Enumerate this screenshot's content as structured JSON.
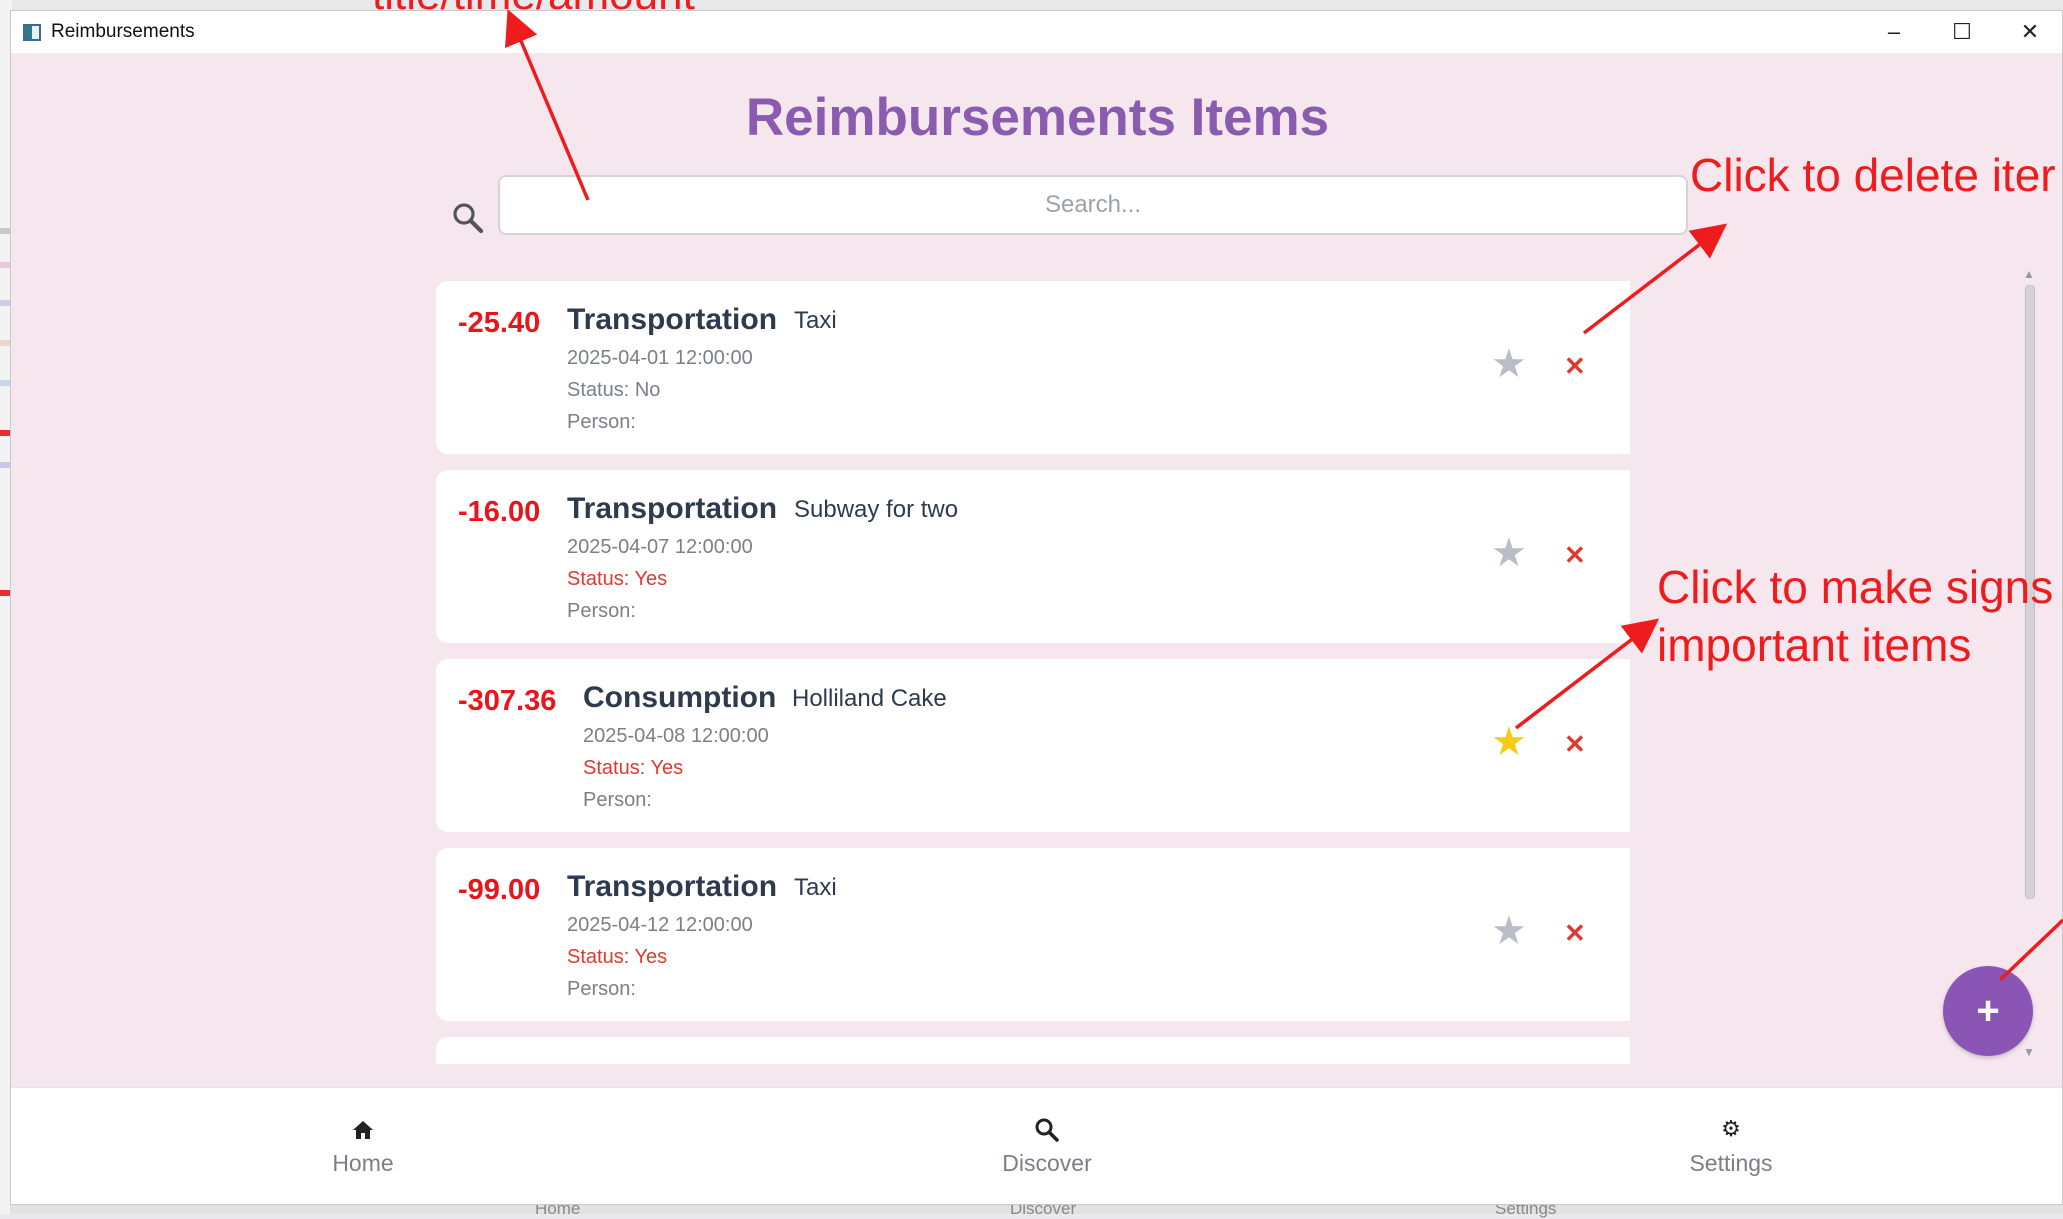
{
  "window": {
    "title": "Reimbursements",
    "controls": {
      "minimize": "–",
      "maximize": "☐",
      "close": "✕"
    }
  },
  "header": {
    "title": "Reimbursements Items",
    "search_placeholder": "Search..."
  },
  "items": [
    {
      "amount": "-25.40",
      "category": "Transportation",
      "description": "Taxi",
      "date": "2025-04-01 12:00:00",
      "status": "Status: No",
      "person": "Person:",
      "starred": false
    },
    {
      "amount": "-16.00",
      "category": "Transportation",
      "description": "Subway for two",
      "date": "2025-04-07 12:00:00",
      "status": "Status: Yes",
      "person": "Person:",
      "starred": false
    },
    {
      "amount": "-307.36",
      "category": "Consumption",
      "description": "Holliland Cake",
      "date": "2025-04-08 12:00:00",
      "status": "Status: Yes",
      "person": "Person:",
      "starred": true
    },
    {
      "amount": "-99.00",
      "category": "Transportation",
      "description": "Taxi",
      "date": "2025-04-12 12:00:00",
      "status": "Status: Yes",
      "person": "Person:",
      "starred": false
    }
  ],
  "item_actions": {
    "star_icon": "star-icon",
    "delete_symbol": "✕"
  },
  "fab": {
    "label": "+"
  },
  "bottom_nav": [
    {
      "label": "Home",
      "icon": "home-icon"
    },
    {
      "label": "Discover",
      "icon": "search-icon"
    },
    {
      "label": "Settings",
      "icon": "gear-icon"
    }
  ],
  "background_nav_labels": [
    "Home",
    "Discover",
    "Settings"
  ],
  "annotations": {
    "search_hint": "title/time/amount",
    "delete_hint": "Click to delete iter",
    "star_hint_line1": "Click to make signs",
    "star_hint_line2": "important items"
  },
  "colors": {
    "accent": "#8a55b5",
    "amount": "#e8151b",
    "status_yes": "#e0392e",
    "star_on": "#f5cc16",
    "star_off": "#b9bec6",
    "window_bg": "#f6e7ef",
    "annotation": "#ee1c1c"
  }
}
